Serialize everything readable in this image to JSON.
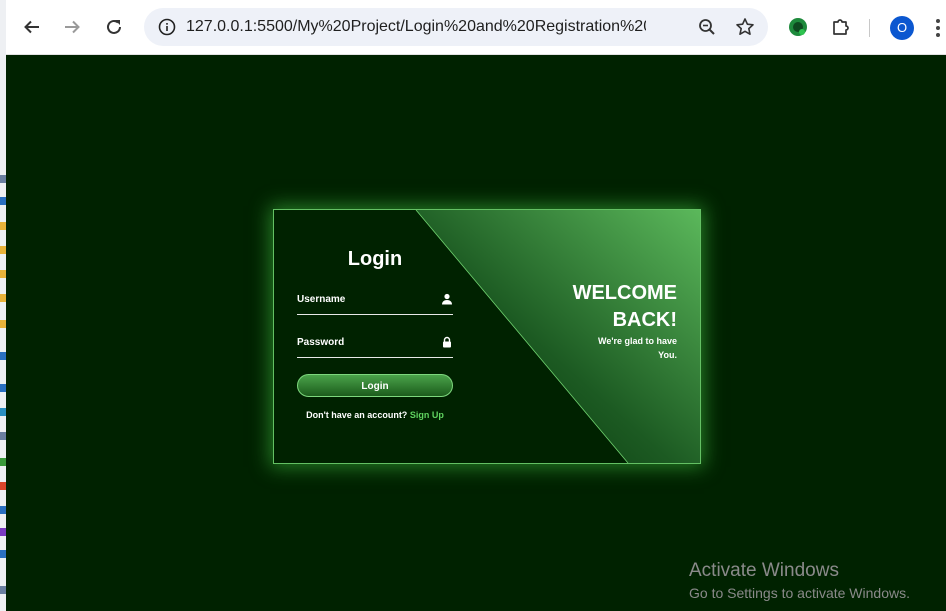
{
  "browser": {
    "url": "127.0.0.1:5500/My%20Project/Login%20and%20Registration%20web...",
    "profile_initial": "O",
    "icons": [
      "back-icon",
      "forward-icon",
      "reload-icon",
      "site-info-icon",
      "zoom-icon",
      "bookmark-star-icon",
      "extension-icon",
      "puzzle-icon",
      "menu-icon"
    ]
  },
  "login": {
    "title": "Login",
    "username_label": "Username",
    "password_label": "Password",
    "button_label": "Login",
    "signup_prompt": "Don't have an account?",
    "signup_link": "Sign Up"
  },
  "welcome": {
    "line1": "WELCOME",
    "line2": "BACK!",
    "sub_line1": "We're glad to have",
    "sub_line2": "You."
  },
  "watermark": {
    "title": "Activate Windows",
    "subtitle": "Go to Settings to activate Windows."
  },
  "colors": {
    "background": "#002200",
    "accent": "#5fd35f",
    "panel_gradient_start": "#1c5a22",
    "panel_gradient_end": "#5bb85b"
  }
}
